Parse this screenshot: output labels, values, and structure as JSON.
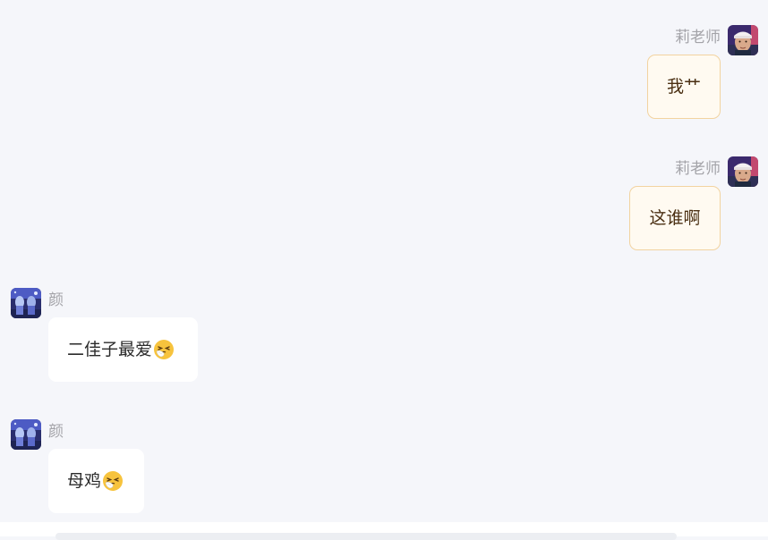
{
  "messages": [
    {
      "side": "right",
      "sender": "莉老师",
      "text": "我艹"
    },
    {
      "side": "right",
      "sender": "莉老师",
      "text": "这谁啊"
    },
    {
      "side": "left",
      "sender": "颜",
      "text": "二佳子最爱",
      "emoji": "sneezing-face-emoji"
    },
    {
      "side": "left",
      "sender": "颜",
      "text": "母鸡",
      "emoji": "sneezing-face-emoji"
    }
  ],
  "colors": {
    "background": "#f5f6fa",
    "my_bubble": "#fffaf1",
    "my_bubble_border": "#f2d3a0",
    "other_bubble": "#ffffff",
    "name_text": "#a3a3a8"
  },
  "icons": {
    "teacher_avatar": "avatar-photo-teacher",
    "yan_avatar": "avatar-anime-yan"
  }
}
